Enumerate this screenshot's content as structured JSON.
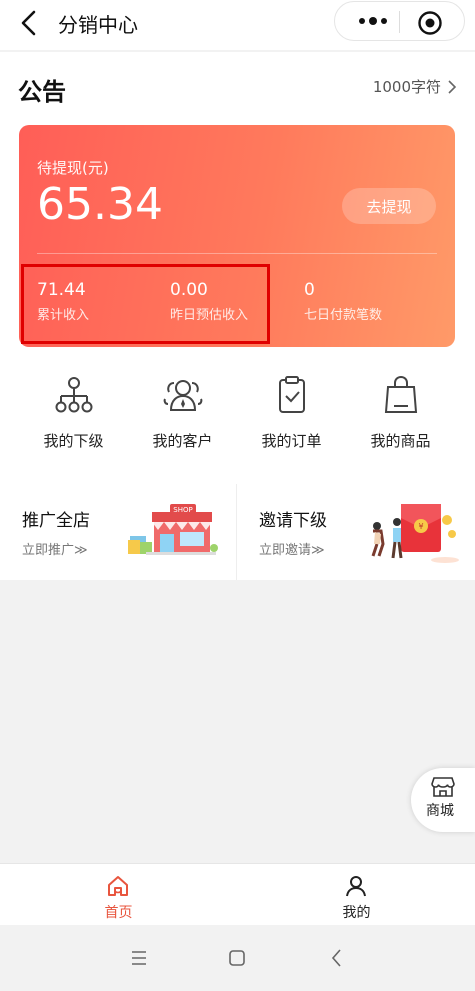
{
  "titlebar": {
    "title": "分销中心"
  },
  "notice": {
    "title": "公告",
    "link_text": "1000字符"
  },
  "wallet": {
    "pending_label": "待提现(元)",
    "pending_amount": "65.34",
    "withdraw_button": "去提现",
    "stats": [
      {
        "value": "71.44",
        "caption": "累计收入"
      },
      {
        "value": "0.00",
        "caption": "昨日预估收入"
      },
      {
        "value": "0",
        "caption": "七日付款笔数"
      }
    ]
  },
  "quick_menu": [
    {
      "label": "我的下级",
      "icon": "hierarchy-icon"
    },
    {
      "label": "我的客户",
      "icon": "customers-icon"
    },
    {
      "label": "我的订单",
      "icon": "clipboard-icon"
    },
    {
      "label": "我的商品",
      "icon": "shopping-bag-icon"
    }
  ],
  "promo": [
    {
      "title": "推广全店",
      "sub": "立即推广≫",
      "image_text": "SHOP"
    },
    {
      "title": "邀请下级",
      "sub": "立即邀请≫"
    }
  ],
  "fab": {
    "label": "商城"
  },
  "tabbar": [
    {
      "label": "首页",
      "active": true
    },
    {
      "label": "我的",
      "active": false
    }
  ],
  "colors": {
    "accent": "#e8553e",
    "card_start": "#ff5e57",
    "card_end": "#ff9a68",
    "highlight": "#e00000"
  }
}
